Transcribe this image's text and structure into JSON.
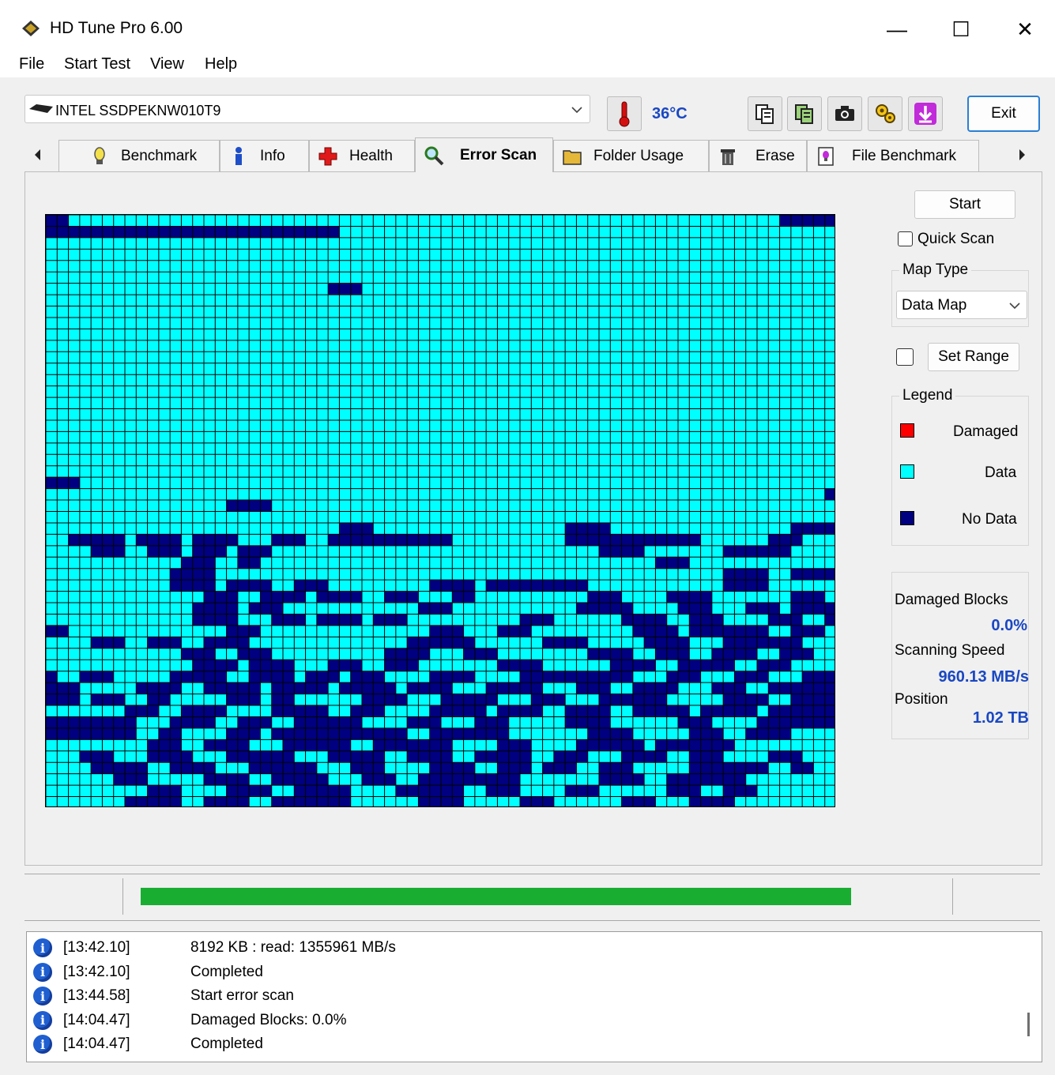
{
  "window": {
    "title": "HD Tune Pro 6.00",
    "minimize_glyph": "—",
    "maximize_glyph": "☐",
    "close_glyph": "✕"
  },
  "menu": [
    "File",
    "Start Test",
    "View",
    "Help"
  ],
  "toolbar": {
    "drive": "INTEL SSDPEKNW010T9",
    "temperature": "36°C",
    "exit_label": "Exit",
    "icons": [
      "copy-info-icon",
      "copy-all-icon",
      "screenshot-icon",
      "options-icon",
      "save-icon"
    ]
  },
  "tabs": [
    "Benchmark",
    "Info",
    "Health",
    "Error Scan",
    "Folder Usage",
    "Erase",
    "File Benchmark"
  ],
  "active_tab": "Error Scan",
  "error_scan": {
    "start_label": "Start",
    "quick_scan_label": "Quick Scan",
    "quick_scan_checked": false,
    "map_type_title": "Map Type",
    "map_type_value": "Data Map",
    "set_range_label": "Set Range",
    "set_range_checked": false,
    "legend_title": "Legend",
    "legend": [
      {
        "label": "Damaged",
        "color": "#ff0000"
      },
      {
        "label": "Data",
        "color": "#00ffff"
      },
      {
        "label": "No Data",
        "color": "#000080"
      }
    ],
    "damaged_blocks_label": "Damaged Blocks",
    "damaged_blocks_value": "0.0%",
    "scanning_speed_label": "Scanning Speed",
    "scanning_speed_value": "960.13 MB/s",
    "position_label": "Position",
    "position_value": "1.02 TB"
  },
  "progress": 1.0,
  "colors": {
    "data": "#00ffff",
    "no_data": "#000080",
    "progress": "#19ad32",
    "accent_text": "#1a47c2"
  },
  "log": [
    {
      "time": "[13:42.10]",
      "message": "8192 KB : read: 1355961 MB/s"
    },
    {
      "time": "[13:42.10]",
      "message": "Completed"
    },
    {
      "time": "[13:44.58]",
      "message": "Start error scan"
    },
    {
      "time": "[14:04.47]",
      "message": "Damaged Blocks: 0.0%"
    },
    {
      "time": "[14:04.47]",
      "message": "Completed"
    }
  ]
}
